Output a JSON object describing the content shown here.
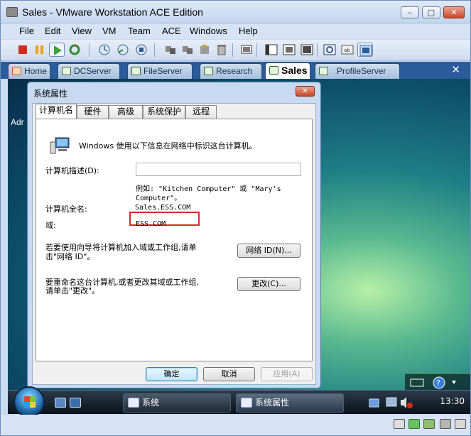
{
  "window": {
    "title": "Sales - VMware Workstation ACE Edition"
  },
  "menu": [
    "File",
    "Edit",
    "View",
    "VM",
    "Team",
    "ACE",
    "Windows",
    "Help"
  ],
  "tabs": [
    {
      "label": "Home"
    },
    {
      "label": "DCServer"
    },
    {
      "label": "FileServer"
    },
    {
      "label": "Research"
    },
    {
      "label": "Sales"
    },
    {
      "label": "ProfileServer"
    }
  ],
  "desktop": {
    "partial_label": "Adr"
  },
  "dialog": {
    "title": "系统属性",
    "tabs": [
      "计算机名",
      "硬件",
      "高级",
      "系统保护",
      "远程"
    ],
    "intro": "Windows 使用以下信息在网络中标识这台计算机。",
    "desc_label": "计算机描述(D):",
    "desc_value": "",
    "example_line1": "例如: \"Kitchen Computer\" 或 \"Mary's",
    "example_line2": "Computer\"。",
    "fullname_label": "计算机全名:",
    "fullname_value": "Sales.ESS.COM",
    "domain_label": "域:",
    "domain_value": "ESS.COM",
    "join_text_1": "若要使用向导将计算机加入域或工作组,请单",
    "join_text_2": "击\"网络 ID\"。",
    "network_id_button": "网络 ID(N)...",
    "rename_text_1": "要重命名这台计算机,或者更改其域或工作组,",
    "rename_text_2": "请单击\"更改\"。",
    "change_button": "更改(C)...",
    "ok_button": "确定",
    "cancel_button": "取消",
    "apply_button": "应用(A)"
  },
  "taskbar": {
    "tasks": [
      {
        "label": "系统"
      },
      {
        "label": "系统属性"
      }
    ],
    "clock": "13:30"
  }
}
